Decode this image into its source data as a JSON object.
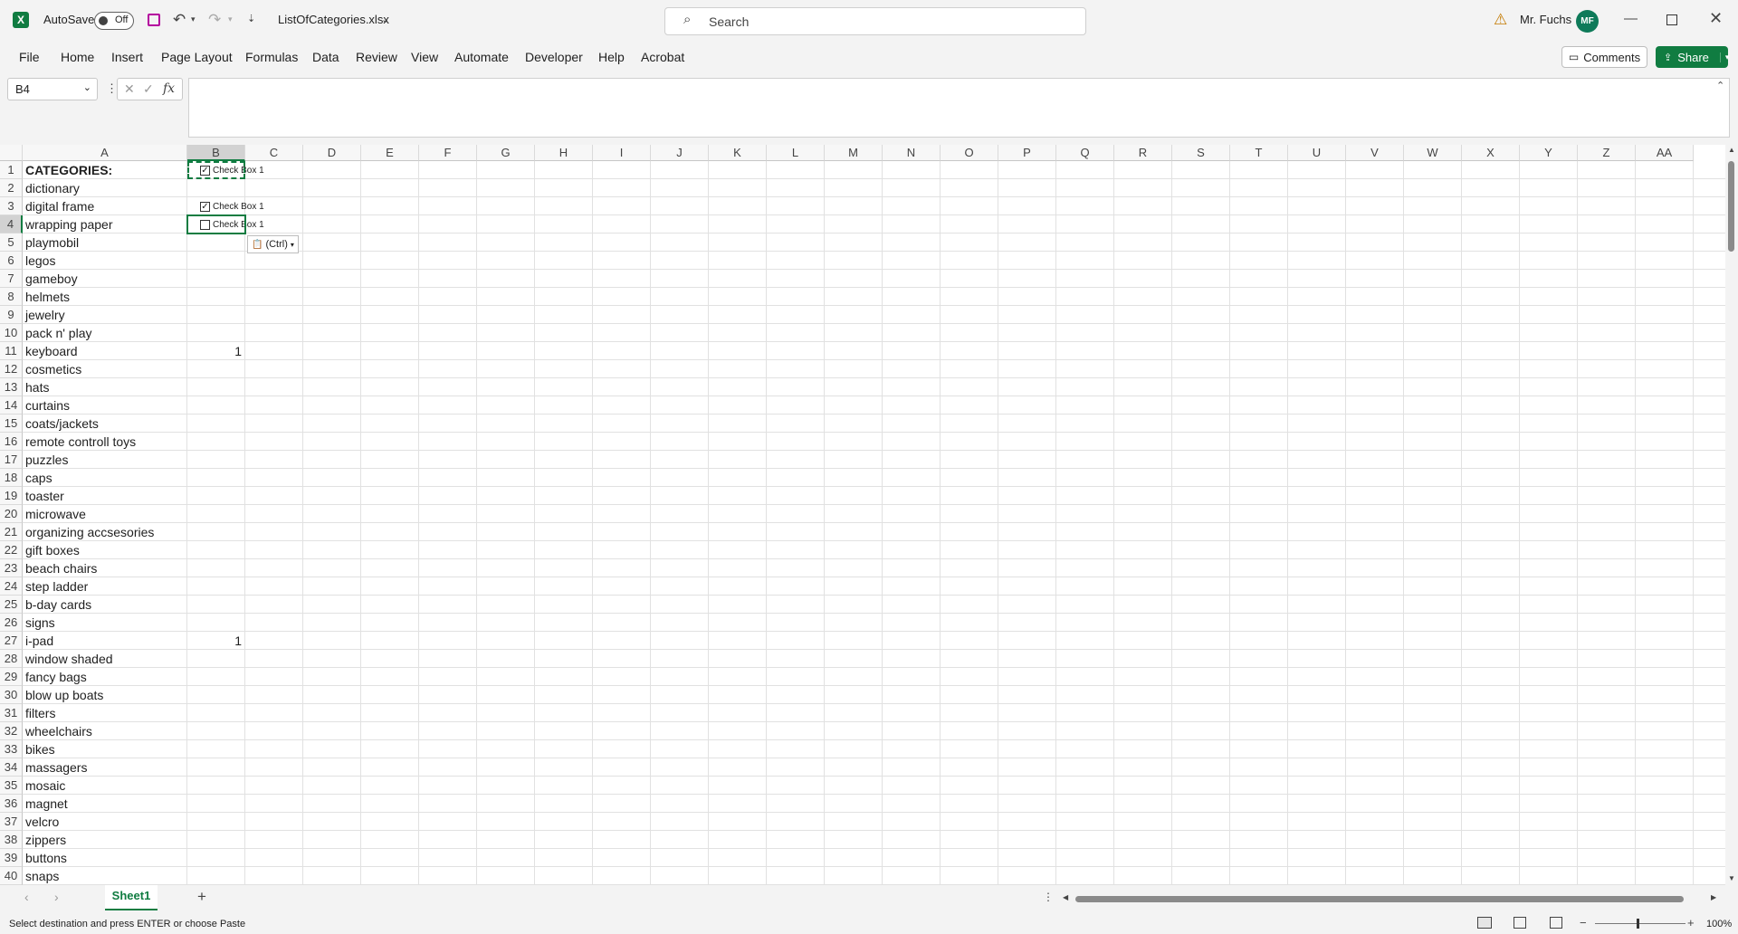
{
  "title_bar": {
    "autosave_label": "AutoSave",
    "autosave_state": "Off",
    "filename": "ListOfCategories.xlsx",
    "search_placeholder": "Search",
    "user_name": "Mr. Fuchs",
    "user_initials": "MF"
  },
  "ribbon": {
    "tabs": [
      "File",
      "Home",
      "Insert",
      "Page Layout",
      "Formulas",
      "Data",
      "Review",
      "View",
      "Automate",
      "Developer",
      "Help",
      "Acrobat"
    ],
    "comments_label": "Comments",
    "share_label": "Share"
  },
  "formula_bar": {
    "name_box": "B4",
    "fx_label": "fx",
    "value": ""
  },
  "grid": {
    "columns": [
      "A",
      "B",
      "C",
      "D",
      "E",
      "F",
      "G",
      "H",
      "I",
      "J",
      "K",
      "L",
      "M",
      "N",
      "O",
      "P",
      "Q",
      "R",
      "S",
      "T",
      "U",
      "V",
      "W",
      "X",
      "Y",
      "Z",
      "AA"
    ],
    "rows": [
      "1",
      "2",
      "3",
      "4",
      "5",
      "6",
      "7",
      "8",
      "9",
      "10",
      "11",
      "12",
      "13",
      "14",
      "15",
      "16",
      "17",
      "18",
      "19",
      "20",
      "21",
      "22",
      "23",
      "24",
      "25",
      "26",
      "27",
      "28",
      "29",
      "30",
      "31",
      "32",
      "33",
      "34",
      "35",
      "36",
      "37",
      "38",
      "39",
      "40"
    ],
    "column_a": [
      "CATEGORIES:",
      "dictionary",
      "digital frame",
      "wrapping paper",
      "playmobil",
      "legos",
      "gameboy",
      "helmets",
      "jewelry",
      "pack n' play",
      "keyboard",
      "cosmetics",
      "hats",
      "curtains",
      "coats/jackets",
      "remote controll toys",
      "puzzles",
      "caps",
      "toaster",
      "microwave",
      "organizing accsesories",
      "gift boxes",
      "beach chairs",
      "step ladder",
      "b-day cards",
      "signs",
      "i-pad",
      "window shaded",
      "fancy bags",
      "blow up boats",
      "filters",
      "wheelchairs",
      "bikes",
      "massagers",
      "mosaic",
      "magnet",
      "velcro",
      "zippers",
      "buttons",
      "snaps"
    ],
    "b11": "1",
    "b27": "1",
    "checkboxes": [
      {
        "label": "Check Box 1",
        "checked": true
      },
      {
        "label": "Check Box 1",
        "checked": true
      },
      {
        "label": "Check Box 1",
        "checked": false
      }
    ],
    "paste_options": "(Ctrl)"
  },
  "sheets": {
    "active": "Sheet1"
  },
  "status": {
    "message": "Select destination and press ENTER or choose Paste",
    "zoom": "100%"
  },
  "colors": {
    "excel_green": "#107c41",
    "avatar": "#0e7a59"
  }
}
